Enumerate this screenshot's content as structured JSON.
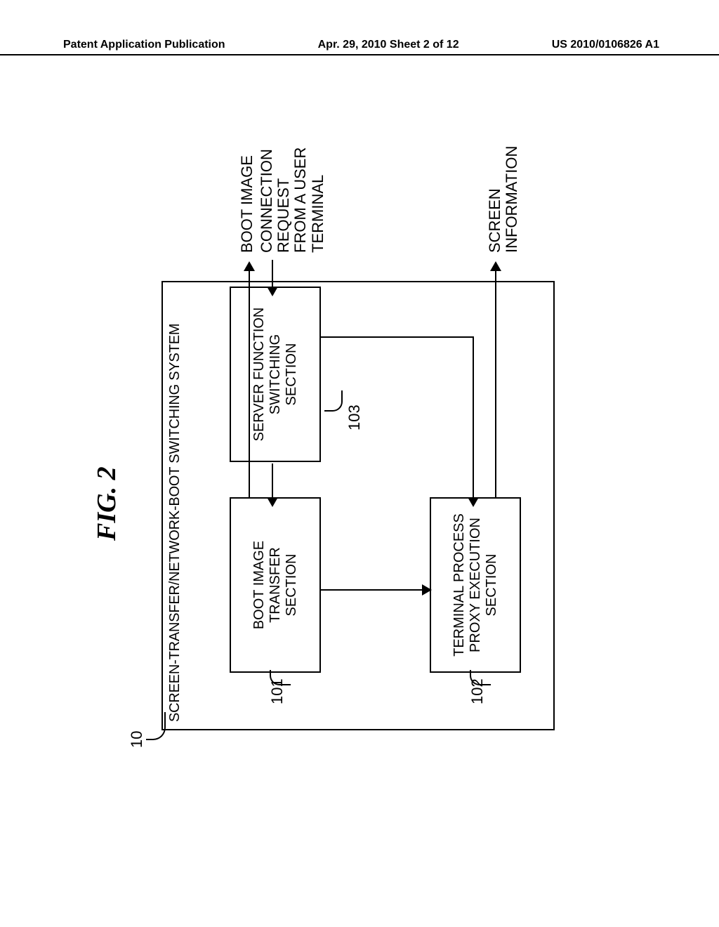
{
  "header": {
    "left": "Patent Application Publication",
    "center": "Apr. 29, 2010  Sheet 2 of 12",
    "right": "US 2010/0106826 A1"
  },
  "figure": {
    "label": "FIG. 2",
    "system_ref": "10",
    "system_title": "SCREEN-TRANSFER/NETWORK-BOOT SWITCHING SYSTEM",
    "blocks": {
      "b101": {
        "ref": "101",
        "text": "BOOT IMAGE\nTRANSFER\nSECTION"
      },
      "b102": {
        "ref": "102",
        "text": "TERMINAL PROCESS\nPROXY EXECUTION\nSECTION"
      },
      "b103": {
        "ref": "103",
        "text": "SERVER FUNCTION\nSWITCHING\nSECTION"
      }
    },
    "io": {
      "boot_image": "BOOT IMAGE",
      "connection_request": "CONNECTION REQUEST\nFROM A USER TERMINAL",
      "screen_information": "SCREEN INFORMATION"
    }
  }
}
